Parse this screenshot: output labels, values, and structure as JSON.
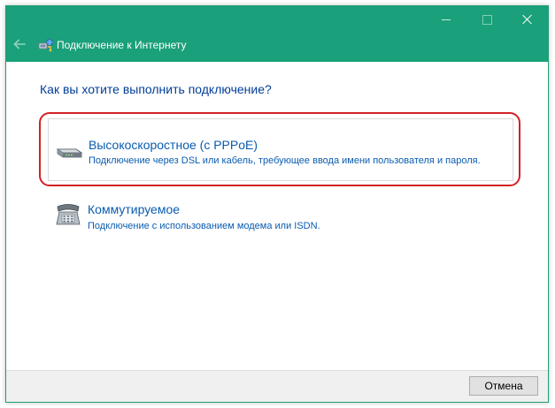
{
  "window": {
    "title": "Подключение к Интернету",
    "accent_color": "#1aa07a",
    "title_icon": "network-connection-icon"
  },
  "titlebar_buttons": {
    "minimize_icon": "minimize-icon",
    "maximize_icon": "maximize-icon",
    "close_icon": "close-icon",
    "back_icon": "back-arrow-icon"
  },
  "main": {
    "question": "Как вы хотите выполнить подключение?",
    "options": [
      {
        "title": "Высокоскоростное (с PPPoE)",
        "description": "Подключение через DSL или кабель, требующее ввода имени пользователя и пароля.",
        "icon": "broadband-modem-icon",
        "highlighted": true,
        "highlight_color": "#d42025"
      },
      {
        "title": "Коммутируемое",
        "description": "Подключение с использованием модема или ISDN.",
        "icon": "dialup-phone-icon",
        "highlighted": false
      }
    ]
  },
  "footer": {
    "cancel_label": "Отмена"
  }
}
